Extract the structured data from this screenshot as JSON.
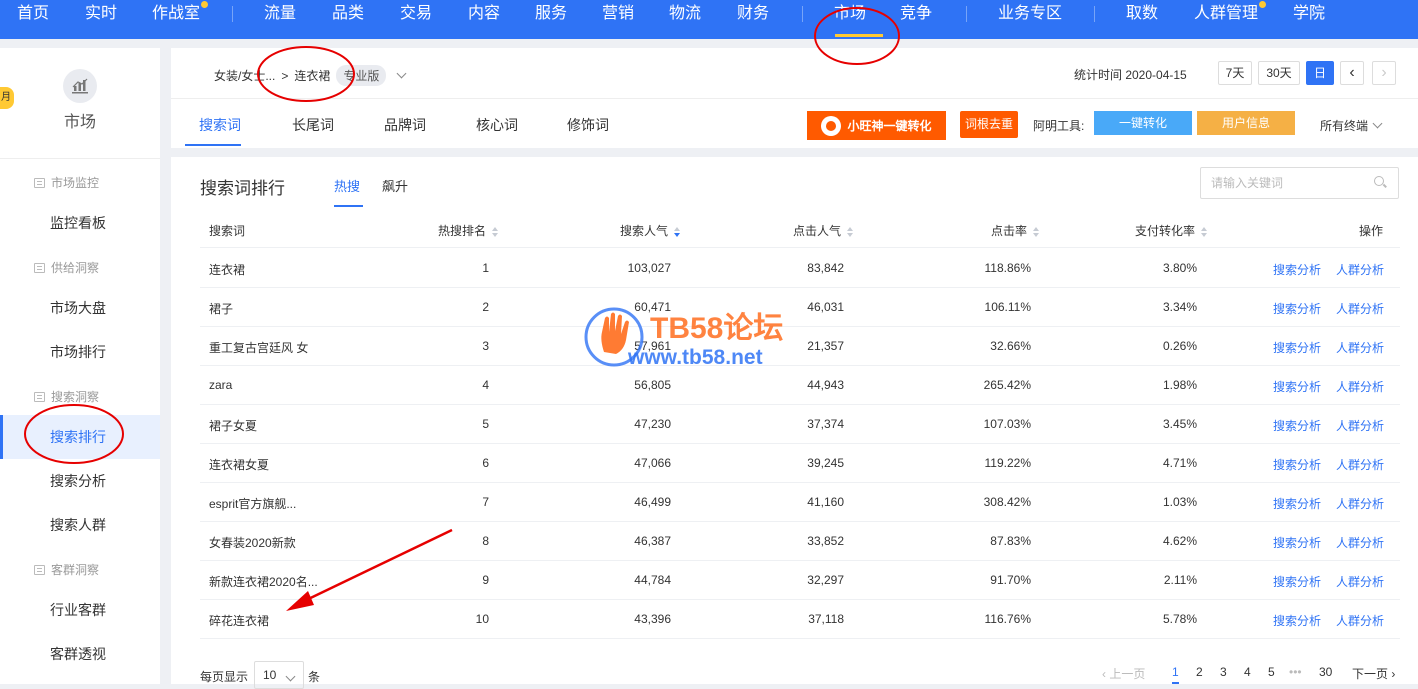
{
  "topnav": {
    "items": [
      "首页",
      "实时",
      "作战室",
      "流量",
      "品类",
      "交易",
      "内容",
      "服务",
      "营销",
      "物流",
      "财务",
      "市场",
      "竞争",
      "业务专区",
      "取数",
      "人群管理",
      "学院"
    ],
    "active": "市场"
  },
  "sidebar": {
    "title": "市场",
    "icon": "chart-icon",
    "badge": "月",
    "groups": [
      {
        "label": "市场监控",
        "items": [
          "监控看板"
        ]
      },
      {
        "label": "供给洞察",
        "items": [
          "市场大盘",
          "市场排行"
        ]
      },
      {
        "label": "搜索洞察",
        "items": [
          "搜索排行",
          "搜索分析",
          "搜索人群"
        ]
      },
      {
        "label": "客群洞察",
        "items": [
          "行业客群",
          "客群透视"
        ]
      }
    ],
    "active": "搜索排行"
  },
  "header": {
    "breadcrumb_parent": "女装/女士...",
    "breadcrumb_sep": ">",
    "breadcrumb_current": "连衣裙",
    "edition": "专业版",
    "stat_time": "统计时间 2020-04-15",
    "range_buttons": [
      "7天",
      "30天",
      "日"
    ],
    "prev": "‹",
    "next": "›"
  },
  "tabs": [
    "搜索词",
    "长尾词",
    "品牌词",
    "核心词",
    "修饰词"
  ],
  "toolbar": {
    "wangwang_label": "小旺神一键转化",
    "dedup_label": "词根去重",
    "tool_label": "阿明工具:",
    "convert_label": "一键转化",
    "userinfo_label": "用户信息",
    "terminal_label": "所有终端"
  },
  "ranking": {
    "title": "搜索词排行",
    "subtabs": [
      "热搜",
      "飙升"
    ],
    "search_placeholder": "请输入关键词",
    "columns": [
      "搜索词",
      "热搜排名",
      "搜索人气",
      "点击人气",
      "点击率",
      "支付转化率",
      "操作"
    ],
    "action_labels": [
      "搜索分析",
      "人群分析"
    ],
    "rows": [
      {
        "word": "连衣裙",
        "rank": "1",
        "search_pop": "103,027",
        "click_pop": "83,842",
        "ctr": "118.86%",
        "cvr": "3.80%"
      },
      {
        "word": "裙子",
        "rank": "2",
        "search_pop": "60,471",
        "click_pop": "46,031",
        "ctr": "106.11%",
        "cvr": "3.34%"
      },
      {
        "word": "重工复古宫廷风 女",
        "rank": "3",
        "search_pop": "57,961",
        "click_pop": "21,357",
        "ctr": "32.66%",
        "cvr": "0.26%"
      },
      {
        "word": "zara",
        "rank": "4",
        "search_pop": "56,805",
        "click_pop": "44,943",
        "ctr": "265.42%",
        "cvr": "1.98%"
      },
      {
        "word": "裙子女夏",
        "rank": "5",
        "search_pop": "47,230",
        "click_pop": "37,374",
        "ctr": "107.03%",
        "cvr": "3.45%"
      },
      {
        "word": "连衣裙女夏",
        "rank": "6",
        "search_pop": "47,066",
        "click_pop": "39,245",
        "ctr": "119.22%",
        "cvr": "4.71%"
      },
      {
        "word": "esprit官方旗舰...",
        "rank": "7",
        "search_pop": "46,499",
        "click_pop": "41,160",
        "ctr": "308.42%",
        "cvr": "1.03%"
      },
      {
        "word": "女春装2020新款",
        "rank": "8",
        "search_pop": "46,387",
        "click_pop": "33,852",
        "ctr": "87.83%",
        "cvr": "4.62%"
      },
      {
        "word": "新款连衣裙2020名...",
        "rank": "9",
        "search_pop": "44,784",
        "click_pop": "32,297",
        "ctr": "91.70%",
        "cvr": "2.11%"
      },
      {
        "word": "碎花连衣裙",
        "rank": "10",
        "search_pop": "43,396",
        "click_pop": "37,118",
        "ctr": "116.76%",
        "cvr": "5.78%"
      }
    ]
  },
  "pagination": {
    "per_page_label": "每页显示",
    "per_page_value": "10",
    "per_page_unit": "条",
    "prev_label": "‹ 上一页",
    "pages": [
      "1",
      "2",
      "3",
      "4",
      "5",
      "•••",
      "30"
    ],
    "current_page": "1",
    "next_label": "下一页 ›"
  },
  "watermark": {
    "line1": "TB58论坛",
    "line2": "www.tb58.net"
  },
  "colors": {
    "primary": "#2f73f5",
    "accent": "#ff5a00",
    "highlight": "#ffc933",
    "annotation": "#e60000"
  }
}
